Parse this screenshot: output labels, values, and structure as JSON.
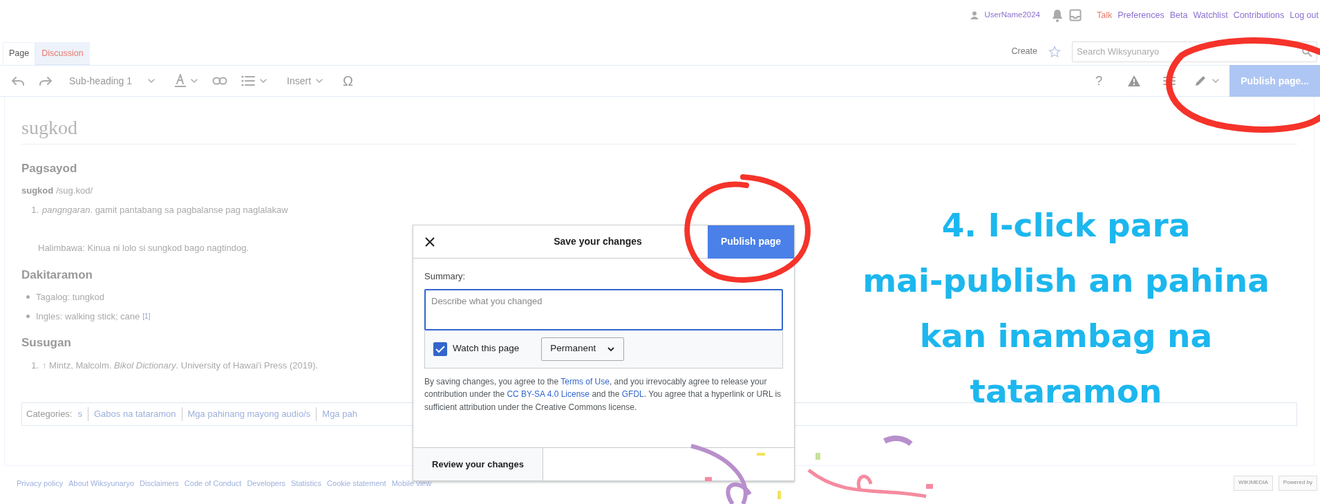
{
  "user_bar": {
    "username": "UserName2024",
    "links": [
      {
        "label": "Talk",
        "missing": true
      },
      {
        "label": "Preferences",
        "missing": false
      },
      {
        "label": "Beta",
        "missing": false
      },
      {
        "label": "Watchlist",
        "missing": false
      },
      {
        "label": "Contributions",
        "missing": false
      },
      {
        "label": "Log out",
        "missing": false
      }
    ]
  },
  "tabs": [
    {
      "label": "Page",
      "selected": true,
      "missing": false
    },
    {
      "label": "Discussion",
      "selected": false,
      "missing": true
    }
  ],
  "actions": {
    "create": "Create",
    "search_placeholder": "Search Wiksyunaryo"
  },
  "toolbar": {
    "heading_style": "Sub-heading 1",
    "insert": "Insert",
    "special_char": "Ω",
    "help": "?",
    "publish": "Publish page..."
  },
  "article": {
    "title": "sugkod",
    "sections": [
      {
        "heading": "Pagsayod",
        "blocks": [
          {
            "kind": "headword",
            "word": "sugkod",
            "pron": "/sug.kod/"
          },
          {
            "kind": "numbered",
            "number": "1.",
            "text": "*pangngaran*. gamit pantabang sa pagbalanse pag naglalakaw"
          },
          {
            "kind": "example",
            "text": "Halimbawa: Kinua ni lolo si sungkod bago nagtindog."
          }
        ]
      },
      {
        "heading": "Dakitaramon",
        "blocks": [
          {
            "kind": "bullet",
            "text": "Tagalog: tungkod"
          },
          {
            "kind": "bullet",
            "text": "Ingles: walking stick; cane",
            "ref": "[1]"
          }
        ]
      },
      {
        "heading": "Susugan",
        "blocks": [
          {
            "kind": "numbered",
            "number": "1.",
            "text": "↑ Mintz, Malcolm. *Bikol Dictionary*. University of Hawai'i Press (2019)."
          }
        ]
      }
    ]
  },
  "categories": {
    "label": "Categories:",
    "items": [
      "s",
      "Gabos na tataramon",
      "Mga pahinang mayong audio/s",
      "Mga pah"
    ]
  },
  "dialog": {
    "title": "Save your changes",
    "publish": "Publish page",
    "summary_label": "Summary:",
    "summary_placeholder": "Describe what you changed",
    "watch": {
      "label": "Watch this page",
      "checked": true
    },
    "watch_period": "Permanent",
    "notice": [
      {
        "text": "By saving changes, you agree to the ",
        "link": false
      },
      {
        "text": "Terms of Use",
        "link": true
      },
      {
        "text": ", and you irrevocably agree to release your contribution under the ",
        "link": false
      },
      {
        "text": "CC BY-SA 4.0 License",
        "link": true
      },
      {
        "text": " and the ",
        "link": false
      },
      {
        "text": "GFDL",
        "link": true
      },
      {
        "text": ". You agree that a hyperlink or URL is sufficient attribution under the Creative Commons license.",
        "link": false
      }
    ],
    "review": "Review your changes"
  },
  "footer": {
    "links": [
      "Privacy policy",
      "About Wiksyunaryo",
      "Disclaimers",
      "Code of Conduct",
      "Developers",
      "Statistics",
      "Cookie statement",
      "Mobile view"
    ],
    "badges": [
      "WIKIMEDIA",
      "Powered by"
    ]
  },
  "callout": {
    "lines": [
      "4. I-click para",
      "mai-publish an pahina",
      "kan inambag na",
      "tataramon"
    ]
  }
}
